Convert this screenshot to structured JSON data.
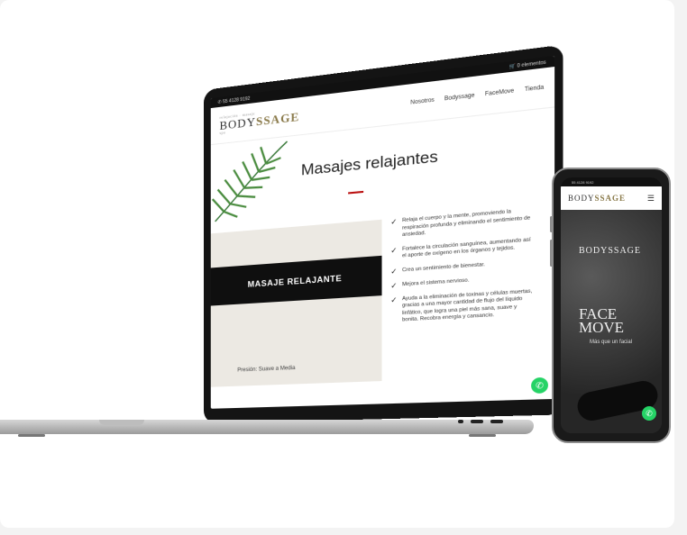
{
  "laptop": {
    "topbar": {
      "phone": "55 4128 9192",
      "cart": "0 elementos"
    },
    "logo": {
      "tagline": "relajación · masaje",
      "brand_part1": "BODY",
      "brand_part2": "SSAGE",
      "subline": "spa"
    },
    "menu": [
      "Nosotros",
      "Bodyssage",
      "FaceMove",
      "Tienda"
    ],
    "title": "Masajes relajantes",
    "band": "MASAJE RELAJANTE",
    "pressure": "Presión: Suave a Media",
    "benefits": [
      "Relaja el cuerpo y la mente, promoviendo la respiración profunda y eliminando el sentimiento de ansiedad.",
      "Fortalece la circulación sanguínea, aumentando así el aporte de oxígeno en los órganos y tejidos.",
      "Crea un sentimiento de bienestar.",
      "Mejora el sistema nervioso.",
      "Ayuda a la eliminación de toxinas y células muertas, gracias a una mayor cantidad de flujo del líquido linfático, que logra una piel más sana, suave y bonita. Recobra energía y cansancio."
    ]
  },
  "phone": {
    "topbar": "55 4128 9192",
    "logo": {
      "brand_part1": "BODY",
      "brand_part2": "SSAGE"
    },
    "hero_logo": "BODYSSAGE",
    "face_line1": "FACE",
    "face_line2": "MOVE",
    "subtitle": "Más que un facial"
  },
  "icons": [
    "check-icon",
    "whatsapp-icon",
    "menu-icon",
    "cart-icon",
    "phone-icon"
  ],
  "colors": {
    "accent_red": "#b11111",
    "whatsapp": "#25d366",
    "gold": "#8a7a4a"
  }
}
